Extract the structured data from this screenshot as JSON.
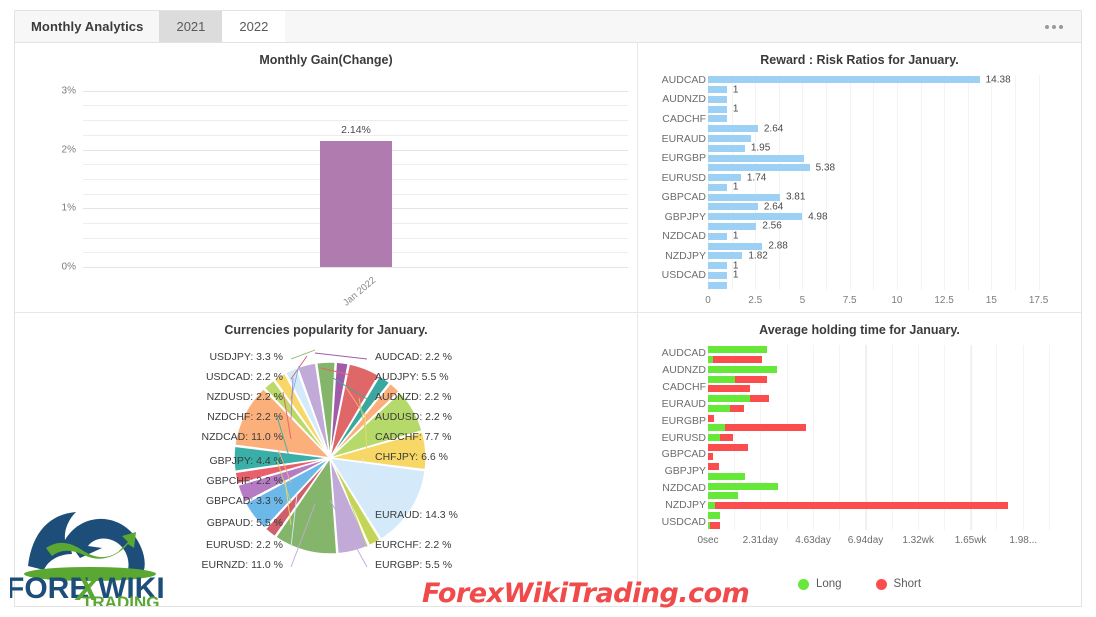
{
  "header": {
    "title": "Monthly Analytics",
    "tabs": [
      {
        "label": "2021",
        "active": false
      },
      {
        "label": "2022",
        "active": true
      }
    ],
    "menu_icon": "more-horizontal-icon"
  },
  "watermark": "ForexWikiTrading.com",
  "logo": {
    "brand_top": "FOREX WIKI",
    "brand_bottom": "TRADING",
    "navy": "#1d4e79",
    "green": "#5aa832"
  },
  "colors": {
    "gain_bar": "#b07cb0",
    "reward_bar": "#9dd0f5",
    "long": "#66e839",
    "short": "#fb4d4d"
  },
  "chart_data": [
    {
      "id": "monthly-gain",
      "type": "bar",
      "title": "Monthly Gain(Change)",
      "categories": [
        "Jan 2022"
      ],
      "values": [
        2.14
      ],
      "data_labels": [
        "2.14%"
      ],
      "ylabel": "",
      "xlabel": "",
      "ylim": [
        0,
        3.2
      ],
      "yticks": [
        0,
        1,
        2,
        3
      ],
      "ytick_labels": [
        "0%",
        "1%",
        "2%",
        "3%"
      ],
      "grid": true,
      "minor_gridlines": true,
      "bar_color": "#b07cb0"
    },
    {
      "id": "reward-risk",
      "type": "bar",
      "orientation": "horizontal",
      "title": "Reward : Risk Ratios for January.",
      "axis_labels": [
        "AUDCAD",
        "AUDNZD",
        "CADCHF",
        "EURAUD",
        "EURGBP",
        "EURUSD",
        "GBPCAD",
        "GBPJPY",
        "NZDCAD",
        "NZDJPY",
        "USDCAD"
      ],
      "values": [
        14.38,
        1,
        1,
        1,
        1,
        2.64,
        2.3,
        1.95,
        5.1,
        5.38,
        1.74,
        1,
        3.81,
        2.64,
        4.98,
        2.56,
        1,
        2.88,
        1.82,
        1,
        1,
        1
      ],
      "data_labels": [
        "14.38",
        "1",
        "",
        "1",
        "",
        "2.64",
        "",
        "1.95",
        "",
        "5.38",
        "1.74",
        "1",
        "3.81",
        "2.64",
        "4.98",
        "2.56",
        "1",
        "2.88",
        "1.82",
        "1",
        "1",
        ""
      ],
      "xlim": [
        0,
        18
      ],
      "xticks": [
        0,
        2.5,
        5,
        7.5,
        10,
        12.5,
        15,
        17.5
      ],
      "xtick_labels": [
        "0",
        "2.5",
        "5",
        "7.5",
        "10",
        "12.5",
        "15",
        "17.5"
      ],
      "grid": true,
      "bar_color": "#9dd0f5"
    },
    {
      "id": "currencies-popularity",
      "type": "pie",
      "title": "Currencies popularity for January.",
      "slices": [
        {
          "label": "AUDCAD",
          "value": 2.2,
          "text": "AUDCAD: 2.2 %",
          "color": "#a05ca8"
        },
        {
          "label": "AUDJPY",
          "value": 5.5,
          "text": "AUDJPY: 5.5 %",
          "color": "#e06767"
        },
        {
          "label": "AUDNZD",
          "value": 2.2,
          "text": "AUDNZD: 2.2 %",
          "color": "#3aa8a0"
        },
        {
          "label": "AUDUSD",
          "value": 2.2,
          "text": "AUDUSD: 2.2 %",
          "color": "#fbb07c"
        },
        {
          "label": "CADCHF",
          "value": 7.7,
          "text": "CADCHF: 7.7 %",
          "color": "#b5d96a"
        },
        {
          "label": "CHFJPY",
          "value": 6.6,
          "text": "CHFJPY: 6.6 %",
          "color": "#f7d766"
        },
        {
          "label": "EURAUD",
          "value": 14.3,
          "text": "EURAUD: 14.3 %",
          "color": "#d4eafb"
        },
        {
          "label": "EURCHF",
          "value": 2.2,
          "text": "EURCHF: 2.2 %",
          "color": "#c3d456"
        },
        {
          "label": "EURGBP",
          "value": 5.5,
          "text": "EURGBP: 5.5 %",
          "color": "#c1a9d8"
        },
        {
          "label": "EURNZD",
          "value": 11.0,
          "text": "EURNZD: 11.0 %",
          "color": "#85b56a"
        },
        {
          "label": "EURUSD",
          "value": 2.2,
          "text": "EURUSD: 2.2 %",
          "color": "#cf5f6b"
        },
        {
          "label": "GBPAUD",
          "value": 5.5,
          "text": "GBPAUD: 5.5 %",
          "color": "#6cb8e8"
        },
        {
          "label": "GBPCAD",
          "value": 3.3,
          "text": "GBPCAD: 3.3 %",
          "color": "#b57cc4"
        },
        {
          "label": "GBPCHF",
          "value": 2.2,
          "text": "GBPCHF: 2.2 %",
          "color": "#e8606c"
        },
        {
          "label": "GBPJPY",
          "value": 4.4,
          "text": "GBPJPY: 4.4 %",
          "color": "#3aafa8"
        },
        {
          "label": "NZDCAD",
          "value": 11.0,
          "text": "NZDCAD: 11.0 %",
          "color": "#fbb07c"
        },
        {
          "label": "NZDCHF",
          "value": 2.2,
          "text": "NZDCHF: 2.2 %",
          "color": "#bcd96a"
        },
        {
          "label": "NZDUSD",
          "value": 2.2,
          "text": "NZDUSD: 2.2 %",
          "color": "#f7d766"
        },
        {
          "label": "USDCAD",
          "value": 2.2,
          "text": "USDCAD: 2.2 %",
          "color": "#d4eafb"
        },
        {
          "label": "USDJPY",
          "value": 3.3,
          "text": "USDJPY: 3.3 %",
          "color": "#c1a9d8"
        },
        {
          "label": "",
          "value": 3.3,
          "text": "",
          "color": "#85b56a"
        }
      ]
    },
    {
      "id": "average-holding-time",
      "type": "bar",
      "orientation": "horizontal",
      "stacked": true,
      "title": "Average holding time for January.",
      "axis_labels": [
        "AUDCAD",
        "AUDNZD",
        "CADCHF",
        "EURAUD",
        "EURGBP",
        "EURUSD",
        "GBPCAD",
        "GBPJPY",
        "NZDCAD",
        "NZDJPY",
        "USDCAD"
      ],
      "legend": [
        {
          "label": "Long",
          "color": "#66e839"
        },
        {
          "label": "Short",
          "color": "#fb4d4d"
        }
      ],
      "legend_position": "bottom",
      "xticks": [
        0,
        2.31,
        4.63,
        6.94,
        9.26,
        11.57,
        13.89
      ],
      "xtick_labels": [
        "0sec",
        "2.31day",
        "4.63day",
        "6.94day",
        "1.32wk",
        "1.65wk",
        "1.98..."
      ],
      "xlim": [
        0,
        15.2
      ],
      "grid": true,
      "rows": [
        {
          "long": 2.6,
          "short": 0
        },
        {
          "long": 0.22,
          "short": 2.18
        },
        {
          "long": 3.05,
          "short": 0
        },
        {
          "long": 1.18,
          "short": 1.4
        },
        {
          "long": 0,
          "short": 1.85
        },
        {
          "long": 1.85,
          "short": 0.85
        },
        {
          "long": 0.95,
          "short": 0.62
        },
        {
          "long": 0,
          "short": 0.28
        },
        {
          "long": 0.77,
          "short": 3.55
        },
        {
          "long": 0.52,
          "short": 0.58
        },
        {
          "long": 0,
          "short": 1.75
        },
        {
          "long": 0,
          "short": 0.22
        },
        {
          "long": 0,
          "short": 0.48
        },
        {
          "long": 1.62,
          "short": 0
        },
        {
          "long": 3.1,
          "short": 0
        },
        {
          "long": 1.3,
          "short": 0
        },
        {
          "long": 0.32,
          "short": 12.9
        },
        {
          "long": 0.55,
          "short": 0
        },
        {
          "long": 0.1,
          "short": 0.42
        }
      ]
    }
  ]
}
